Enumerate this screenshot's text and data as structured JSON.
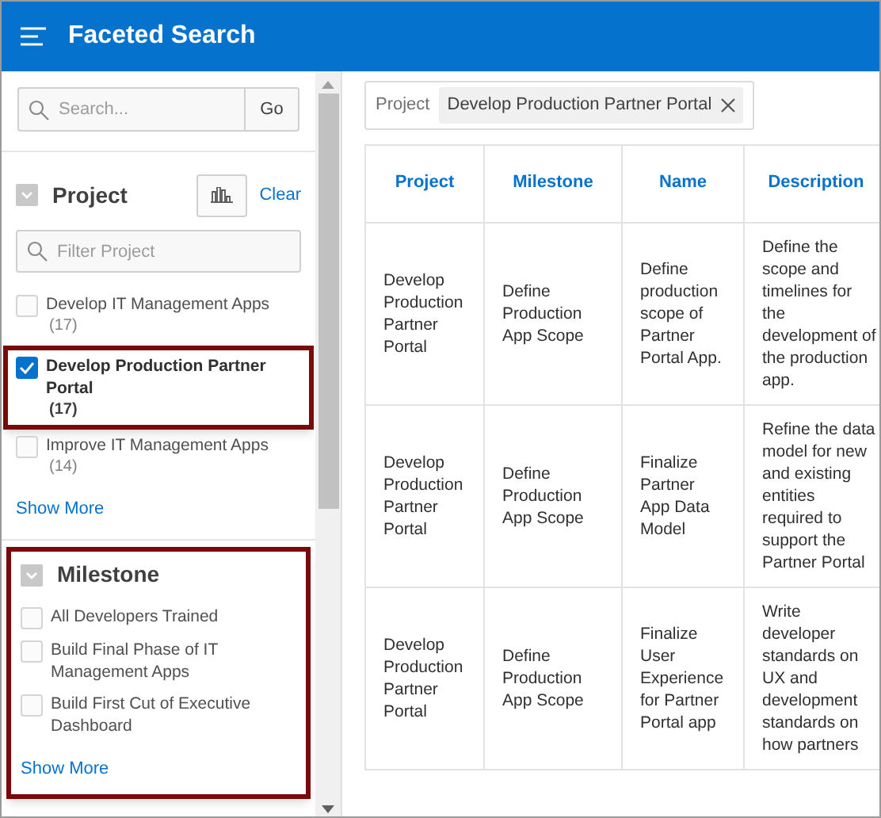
{
  "header": {
    "title": "Faceted Search"
  },
  "search": {
    "placeholder": "Search...",
    "button": "Go"
  },
  "facets": [
    {
      "kind": "checklist",
      "title": "Project",
      "chart_button": true,
      "clear": "Clear",
      "filter_placeholder": "Filter Project",
      "highlighted": false,
      "items": [
        {
          "label": "Develop IT Management Apps",
          "count": "(17)",
          "checked": false,
          "highlighted": false
        },
        {
          "label": "Develop Production Partner Portal",
          "count": "(17)",
          "checked": true,
          "highlighted": true
        },
        {
          "label": "Improve IT Management Apps",
          "count": "(14)",
          "checked": false,
          "highlighted": false
        }
      ],
      "show_more": "Show More"
    },
    {
      "kind": "checklist",
      "title": "Milestone",
      "chart_button": false,
      "highlighted": true,
      "items": [
        {
          "label": "All Developers Trained",
          "checked": false,
          "highlighted": false
        },
        {
          "label": "Build Final Phase of IT Management Apps",
          "checked": false,
          "highlighted": false
        },
        {
          "label": "Build First Cut of Executive Dashboard",
          "checked": false,
          "highlighted": false
        }
      ],
      "show_more": "Show More"
    }
  ],
  "active_filter": {
    "facet": "Project",
    "value": "Develop Production Partner Portal"
  },
  "table": {
    "columns": [
      "Project",
      "Milestone",
      "Name",
      "Description"
    ],
    "rows": [
      [
        "Develop Production Partner Portal",
        "Define Production App Scope",
        "Define production scope of Partner Portal App.",
        "Define the scope and timelines for the development of the production app."
      ],
      [
        "Develop Production Partner Portal",
        "Define Production App Scope",
        "Finalize Partner App Data Model",
        "Refine the data model for new and existing entities required to support the Partner Portal"
      ],
      [
        "Develop Production Partner Portal",
        "Define Production App Scope",
        "Finalize User Experience for Partner Portal app",
        "Write developer standards on UX and development standards on how partners"
      ]
    ]
  }
}
